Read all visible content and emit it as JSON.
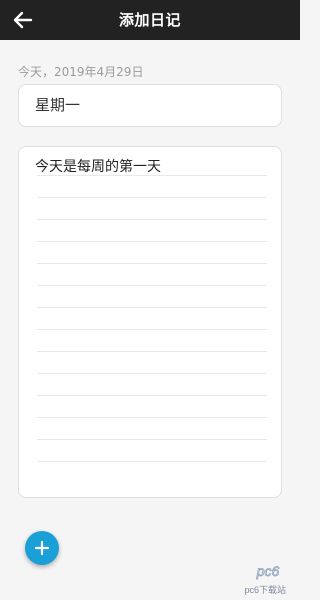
{
  "header": {
    "title": "添加日记",
    "back_icon": "arrow-left-icon"
  },
  "diary": {
    "date": "今天，2019年4月29日",
    "title": "星期一",
    "content": "今天是每周的第一天"
  },
  "fab": {
    "icon": "plus-icon",
    "color": "#1a9fd7"
  },
  "watermark": {
    "logo": "pc6",
    "text": "pc6下载站"
  },
  "colors": {
    "header_bg": "#222222",
    "page_bg": "#f5f5f5",
    "accent": "#1a9fd7"
  }
}
